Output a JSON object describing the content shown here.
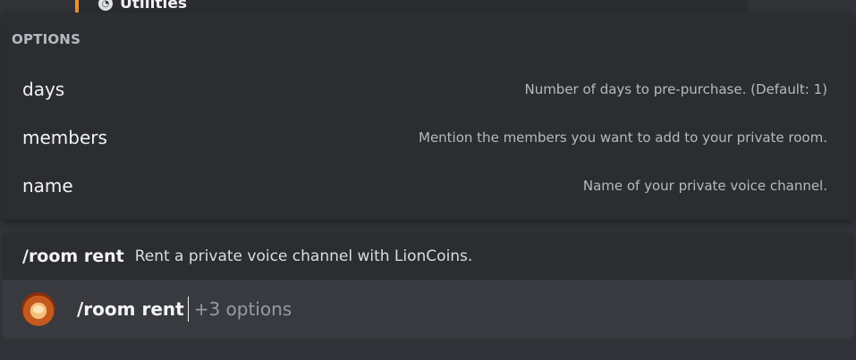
{
  "top_category": {
    "label": "Utilities",
    "icon": "gauge-icon",
    "accent_color": "#f0922c"
  },
  "options_panel": {
    "heading": "OPTIONS",
    "options": [
      {
        "name": "days",
        "description": "Number of days to pre-purchase. (Default: 1)"
      },
      {
        "name": "members",
        "description": "Mention the members you want to add to your private room."
      },
      {
        "name": "name",
        "description": "Name of your private voice channel."
      }
    ]
  },
  "command": {
    "name": "/room rent",
    "description": "Rent a private voice channel with LionCoins."
  },
  "input": {
    "value": "/room rent",
    "hint": "+3 options",
    "avatar_icon": "lion-avatar-icon"
  },
  "colors": {
    "background": "#313338",
    "panel": "#2b2d31",
    "input": "#383a40",
    "text_primary": "#f2f3f5",
    "text_muted": "#b5bac1"
  }
}
